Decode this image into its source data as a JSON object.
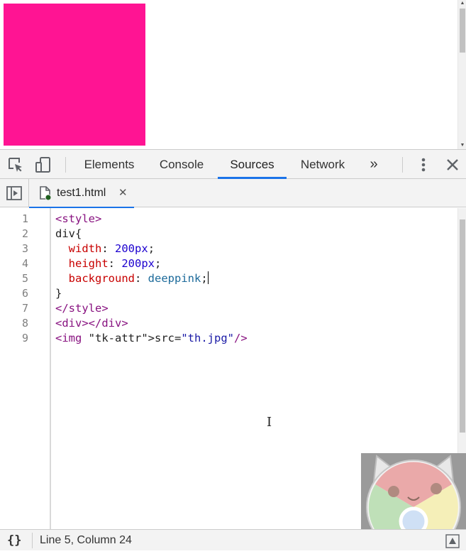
{
  "page": {
    "box_color": "#ff1493"
  },
  "devtools": {
    "tabs": [
      {
        "label": "Elements"
      },
      {
        "label": "Console"
      },
      {
        "label": "Sources"
      },
      {
        "label": "Network"
      }
    ],
    "active_tab": "Sources",
    "more_tabs_label": "»",
    "accent_color": "#1a73e8",
    "icons": {
      "inspect": "inspect-element-icon",
      "device": "device-toolbar-icon",
      "menu": "kebab-menu-icon",
      "close": "close-icon"
    }
  },
  "sources": {
    "navigator_icon": "navigator-toggle-icon",
    "open_file": {
      "name": "test1.html",
      "close_glyph": "✕",
      "modified": true
    },
    "code_lines": [
      {
        "number": "1",
        "text": "<style>"
      },
      {
        "number": "2",
        "text": "div{"
      },
      {
        "number": "3",
        "text": "  width: 200px;"
      },
      {
        "number": "4",
        "text": "  height: 200px;"
      },
      {
        "number": "5",
        "text": "  background: deeppink;"
      },
      {
        "number": "6",
        "text": "}"
      },
      {
        "number": "7",
        "text": "</style>"
      },
      {
        "number": "8",
        "text": "<div></div>"
      },
      {
        "number": "9",
        "text": "<img src=\"th.jpg\"/>"
      }
    ]
  },
  "status_bar": {
    "pretty_print_label": "{}",
    "cursor_position": "Line 5, Column 24"
  }
}
